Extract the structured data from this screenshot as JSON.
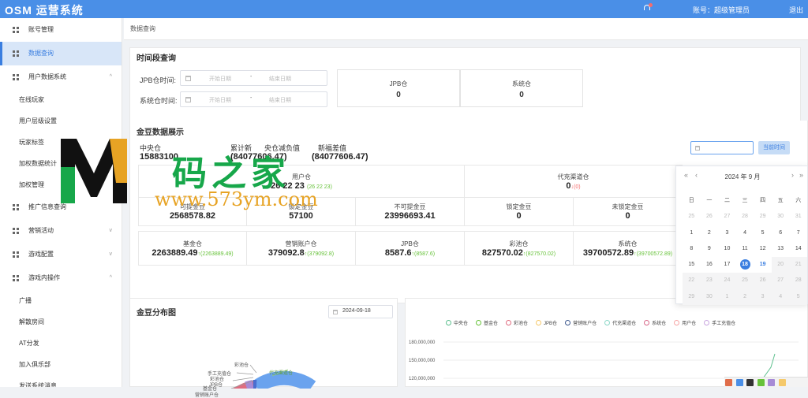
{
  "app": {
    "title": "OSM 运营系统",
    "account": "账号：超级管理员",
    "logout": "退出"
  },
  "sidebar": {
    "items": [
      {
        "label": "账号管理"
      },
      {
        "label": "数据查询",
        "active": true
      },
      {
        "label": "用户数据系统",
        "chevron": "^"
      },
      {
        "label": "在线玩家"
      },
      {
        "label": "用户层级设置"
      },
      {
        "label": "玩家标签"
      },
      {
        "label": "加权数据统计"
      },
      {
        "label": "加权管理"
      },
      {
        "label": "推广信息查询"
      },
      {
        "label": "营销活动",
        "chevron": "v"
      },
      {
        "label": "游戏配置",
        "chevron": "v"
      },
      {
        "label": "游戏内操作",
        "chevron": "^"
      },
      {
        "label": "广播"
      },
      {
        "label": "解散房间"
      },
      {
        "label": "AT分发"
      },
      {
        "label": "加入俱乐部"
      },
      {
        "label": "发送系统消息"
      }
    ]
  },
  "breadcrumb": "数据查询",
  "period": {
    "title": "时间段查询",
    "jpb_label": "JPB仓时间:",
    "sys_label": "系统仓时间:",
    "start_placeholder": "开始日期",
    "sep": "-",
    "end_placeholder": "结束日期",
    "boxes": [
      {
        "label": "JPB仓",
        "value": "0"
      },
      {
        "label": "系统仓",
        "value": "0"
      }
    ]
  },
  "gold": {
    "title": "金豆数据展示",
    "summary": [
      {
        "label": "中央仓",
        "value": "15883100"
      },
      {
        "label": "累计新",
        "value": "(84077606.47)"
      },
      {
        "label": "央仓减负值",
        "value": ""
      },
      {
        "label": "新福差值",
        "value": "(84077606.47)"
      }
    ],
    "picker_button": "当前时间",
    "user_cell": {
      "label": "用户仓",
      "value": "26 22 23",
      "change": "(26 22 23)"
    },
    "agent_cell": {
      "label": "代充渠道仓",
      "value": "0",
      "change": "↓(0)"
    },
    "row2": [
      {
        "label": "可提金豆",
        "value": "2568578.82"
      },
      {
        "label": "锁定金豆",
        "value": "57100"
      },
      {
        "label": "不可提金豆",
        "value": "23996693.41"
      },
      {
        "label": "锁定金豆",
        "value": "0"
      },
      {
        "label": "未锁定金豆",
        "value": "0"
      }
    ],
    "row3": [
      {
        "label": "基金仓",
        "value": "2263889.49",
        "change": "↑(2263889.49)"
      },
      {
        "label": "营销账户仓",
        "value": "379092.8",
        "change": "↑(379092.8)"
      },
      {
        "label": "JPB仓",
        "value": "8587.6",
        "change": "↑(8587.6)"
      },
      {
        "label": "彩池仓",
        "value": "827570.02",
        "change": "↑(827570.02)"
      },
      {
        "label": "系统仓",
        "value": "39700572.89",
        "change": "↑(39700572.89)"
      }
    ]
  },
  "calendar": {
    "month_label": "2024 年  9 月",
    "weekdays": [
      "日",
      "一",
      "二",
      "三",
      "四",
      "五",
      "六"
    ],
    "weeks": [
      [
        "25",
        "26",
        "27",
        "28",
        "29",
        "30",
        "31"
      ],
      [
        "1",
        "2",
        "3",
        "4",
        "5",
        "6",
        "7"
      ],
      [
        "8",
        "9",
        "10",
        "11",
        "12",
        "13",
        "14"
      ],
      [
        "15",
        "16",
        "17",
        "18",
        "19",
        "20",
        "21"
      ],
      [
        "22",
        "23",
        "24",
        "25",
        "26",
        "27",
        "28"
      ],
      [
        "29",
        "30",
        "1",
        "2",
        "3",
        "4",
        "5"
      ]
    ],
    "today": "18",
    "selected_next": "19"
  },
  "distribution": {
    "title": "金豆分布图",
    "date": "2024-09-18",
    "labels": [
      "彩池仓",
      "代充渠道仓",
      "手工充值仓",
      "彩池仓",
      "JPB仓",
      "基金仓",
      "营销账户仓"
    ],
    "colors": [
      "#6aa3ee",
      "#e06d80",
      "#91cc75",
      "#a78bd6",
      "#f5c96b",
      "#4a6fd0"
    ]
  },
  "chart_data": {
    "type": "line",
    "series": [
      {
        "name": "中央仓"
      },
      {
        "name": "基金仓"
      },
      {
        "name": "彩池仓"
      },
      {
        "name": "JPB仓"
      },
      {
        "name": "营销账户仓"
      },
      {
        "name": "代充渠道仓"
      },
      {
        "name": "系统仓"
      },
      {
        "name": "用户仓"
      },
      {
        "name": "手工充值仓"
      }
    ],
    "series_colors": [
      "#5ec08f",
      "#67c23a",
      "#e06d80",
      "#f5c96b",
      "#3f5a8f",
      "#8dd8c8",
      "#d86a8a",
      "#f7a7a7",
      "#c9a6e0"
    ],
    "yticks": [
      "180,000,000",
      "150,000,000",
      "120,000,000"
    ]
  }
}
